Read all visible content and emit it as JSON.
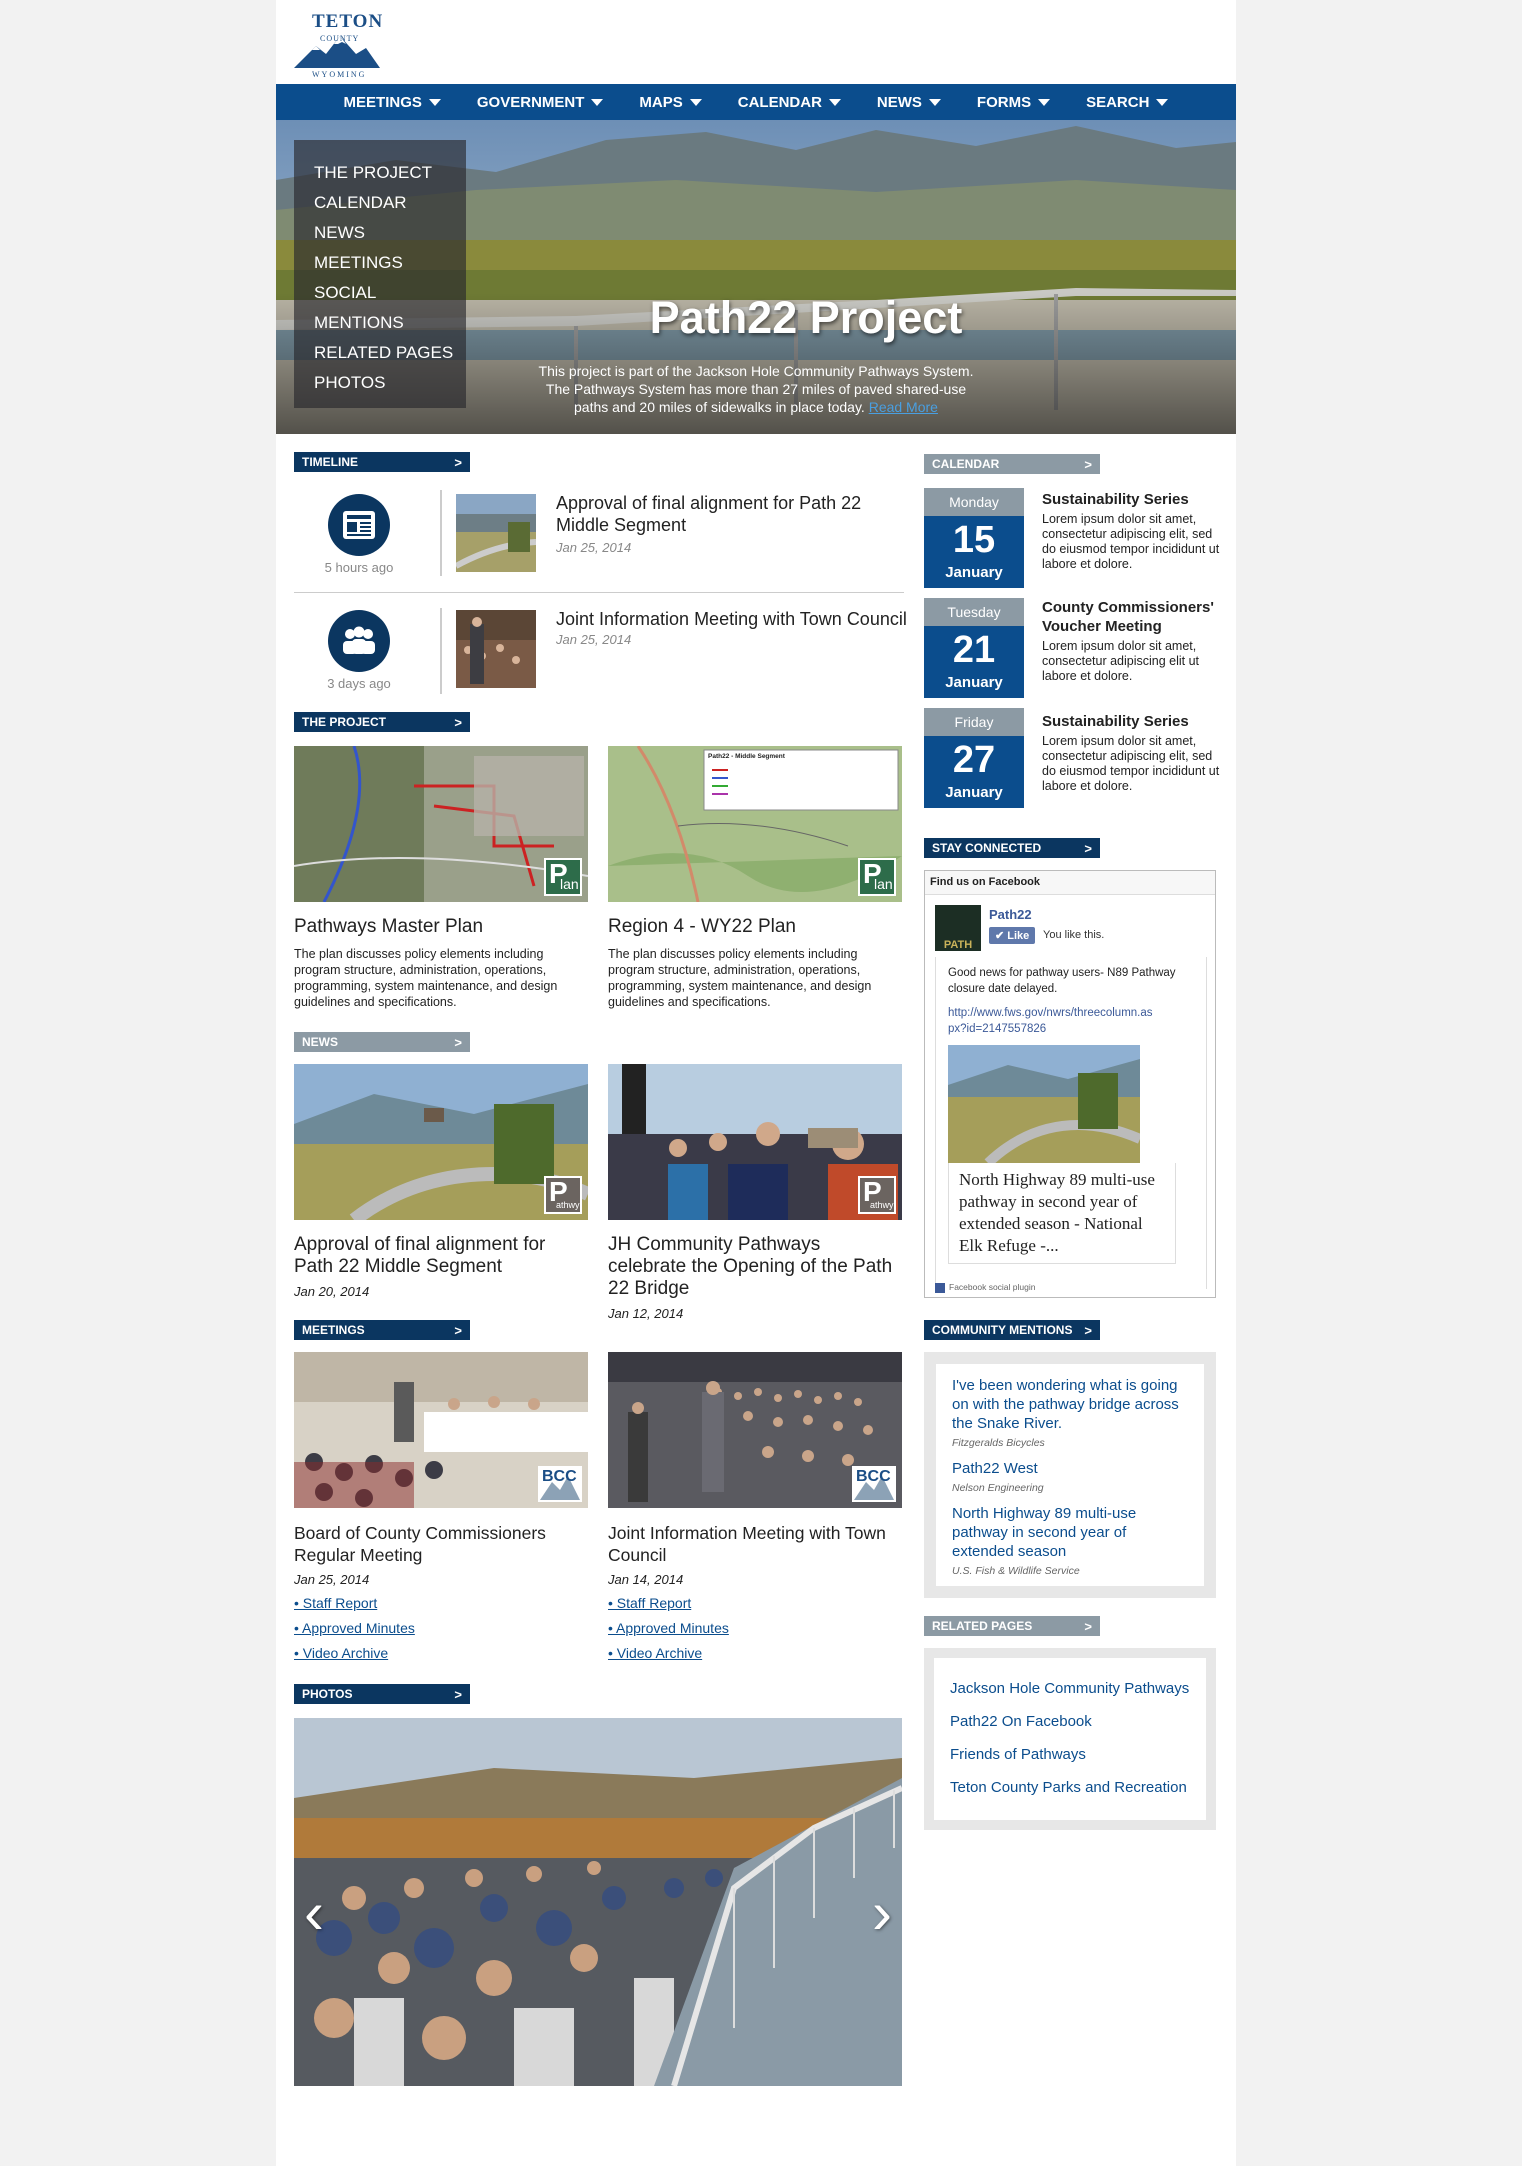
{
  "logo": {
    "line1": "TETON",
    "line2": "COUNTY",
    "state": "WYOMING"
  },
  "topnav": [
    "MEETINGS",
    "GOVERNMENT",
    "MAPS",
    "CALENDAR",
    "NEWS",
    "FORMS",
    "SEARCH"
  ],
  "sidenav": [
    "THE PROJECT",
    "CALENDAR",
    "NEWS",
    "MEETINGS",
    "SOCIAL",
    "MENTIONS",
    "RELATED PAGES",
    "PHOTOS"
  ],
  "hero": {
    "title": "Path22 Project",
    "desc_line1": "This project is part of the Jackson Hole Community Pathways System.",
    "desc_line2": "The Pathways System has more than 27 miles of paved shared-use",
    "desc_line3": "paths and 20 miles of sidewalks in place today.",
    "read_more": "Read More"
  },
  "sections": {
    "timeline": "TIMELINE",
    "project": "THE PROJECT",
    "news": "NEWS",
    "meetings": "MEETINGS",
    "photos": "PHOTOS",
    "calendar": "CALENDAR",
    "stay": "STAY CONNECTED",
    "mentions": "COMMUNITY MENTIONS",
    "related": "RELATED PAGES",
    "arrow": ">"
  },
  "timeline": [
    {
      "ago": "5 hours ago",
      "title": "Approval of final alignment for Path 22 Middle Segment",
      "date": "Jan 25, 2014",
      "icon": "newspaper-icon"
    },
    {
      "ago": "3 days ago",
      "title": "Joint Information Meeting with Town Council",
      "date": "Jan 25, 2014",
      "icon": "people-icon"
    }
  ],
  "project": [
    {
      "title": "Pathways Master Plan",
      "desc": "The plan discusses policy elements including program structure, administration, operations, programming, system maintenance, and design guidelines and specifications.",
      "badge_big": "P",
      "badge_small": "lan"
    },
    {
      "title": "Region 4 - WY22 Plan",
      "desc": "The plan discusses policy elements including program structure, administration, operations, programming, system maintenance, and design guidelines and specifications.",
      "badge_big": "P",
      "badge_small": "lan",
      "map_title": "Path22 - Middle Segment"
    }
  ],
  "news": [
    {
      "title": "Approval of final alignment for Path 22 Middle Segment",
      "date": "Jan 20, 2014",
      "badge_big": "P",
      "badge_small": "athwy"
    },
    {
      "title": "JH Community Pathways celebrate the Opening of the Path 22 Bridge",
      "date": "Jan 12, 2014",
      "badge_big": "P",
      "badge_small": "athwy"
    }
  ],
  "meetings": [
    {
      "title": "Board of County Commissioners Regular Meeting",
      "date": "Jan 25, 2014",
      "links": [
        "• Staff Report",
        "• Approved Minutes",
        "• Video Archive"
      ],
      "badge": "BCC"
    },
    {
      "title": "Joint Information Meeting with Town Council",
      "date": "Jan 14, 2014",
      "links": [
        "• Staff Report",
        "• Approved Minutes",
        "• Video Archive"
      ],
      "badge": "BCC"
    }
  ],
  "calendar": [
    {
      "day": "Monday",
      "num": "15",
      "month": "January",
      "title": "Sustainability Series",
      "desc": "Lorem ipsum dolor sit amet, consectetur adipiscing elit, sed do eiusmod tempor incididunt ut labore et dolore."
    },
    {
      "day": "Tuesday",
      "num": "21",
      "month": "January",
      "title": "County Commissioners' Voucher Meeting",
      "desc": "Lorem ipsum dolor sit amet, consectetur adipiscing elit ut labore et dolore."
    },
    {
      "day": "Friday",
      "num": "27",
      "month": "January",
      "title": "Sustainability Series",
      "desc": "Lorem ipsum dolor sit amet, consectetur adipiscing elit, sed do eiusmod tempor incididunt ut labore et dolore."
    }
  ],
  "facebook": {
    "header": "Find us on Facebook",
    "page": "Path22",
    "avatar": "PATH",
    "like": "Like",
    "you_like": "You like this.",
    "post": "Good news for pathway users- N89 Pathway closure date delayed.",
    "link": "http://www.fws.gov/nwrs/threecolumn.aspx?id=2147557826",
    "link_line1": "http://www.fws.gov/nwrs/threecolumn.as",
    "link_line2": "px?id=2147557826",
    "headline": "North Highway 89 multi-use pathway in second year of extended season - National Elk Refuge -...",
    "footer": "Facebook social plugin"
  },
  "mentions": [
    {
      "text": "I've been wondering what is going on with the pathway bridge across the Snake River.",
      "source": "Fitzgeralds Bicycles"
    },
    {
      "text": "Path22 West",
      "source": "Nelson Engineering"
    },
    {
      "text": "North Highway 89 multi-use pathway in second year of extended season",
      "source": "U.S. Fish & Wildlife Service"
    }
  ],
  "related": [
    "Jackson Hole Community Pathways",
    "Path22 On Facebook",
    "Friends of Pathways",
    "Teton County Parks and Recreation"
  ],
  "photos": {
    "prev": "‹",
    "next": "›"
  }
}
